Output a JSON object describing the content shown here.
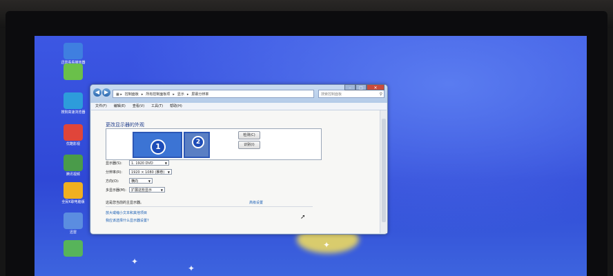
{
  "desktop": {
    "icons": [
      {
        "label": "迅雷看看播放器",
        "color": "#3f7fe0"
      },
      {
        "label": "",
        "color": "#6ac04a"
      },
      {
        "label": "搜狗高速浏览器",
        "color": "#2d9cdb"
      },
      {
        "label": "优酷影视",
        "color": "#e0453a"
      },
      {
        "label": "腾讯视频",
        "color": "#4a9b4a"
      },
      {
        "label": "全民K歌电脑版",
        "color": "#f0b020"
      },
      {
        "label": "迅雷",
        "color": "#5b8de0"
      },
      {
        "label": "",
        "color": "#57b45a"
      }
    ]
  },
  "window": {
    "address_parts": [
      "控制面板",
      "所有控制面板项",
      "显示",
      "屏幕分辨率"
    ],
    "search_placeholder": "搜索控制面板",
    "menu": [
      "文件(F)",
      "编辑(E)",
      "查看(V)",
      "工具(T)",
      "帮助(H)"
    ],
    "heading": "更改显示器的外观",
    "monitors": [
      "1",
      "2"
    ],
    "detect_button": "检测(C)",
    "identify_button": "识别(I)",
    "fields": [
      {
        "label": "显示器(S):",
        "value": "1. 1920 DVD"
      },
      {
        "label": "分辨率(R):",
        "value": "1920 × 1080 (推荐)"
      },
      {
        "label": "方向(O):",
        "value": "横向"
      },
      {
        "label": "多显示器(M):",
        "value": "扩展这些显示"
      }
    ],
    "primary_text": "这是您当前的主显示器。",
    "advanced_link": "高级设置",
    "links": [
      "放大或缩小文本和其他项目",
      "我应该选择什么显示器设置?"
    ]
  }
}
